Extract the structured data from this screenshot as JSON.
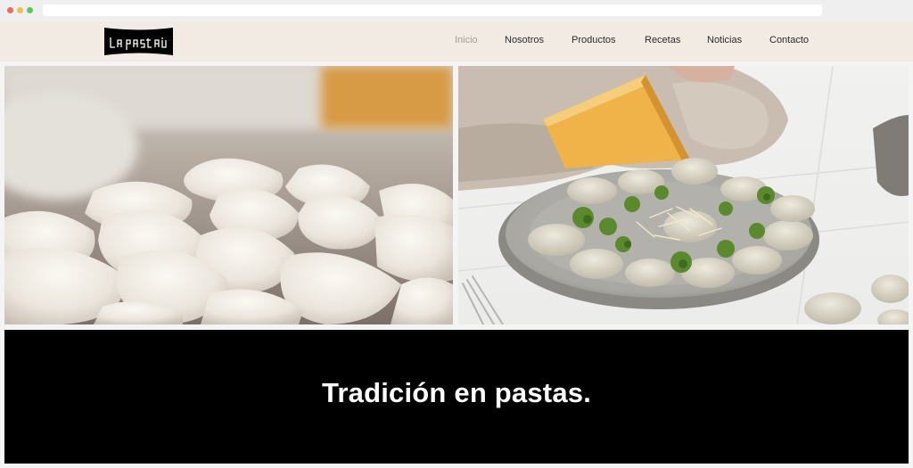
{
  "browser": {
    "window_controls": [
      "close",
      "minimize",
      "maximize"
    ],
    "url": ""
  },
  "header": {
    "logo_text": "la pasta",
    "nav": [
      {
        "label": "Inicio",
        "active": true
      },
      {
        "label": "Nosotros",
        "active": false
      },
      {
        "label": "Productos",
        "active": false
      },
      {
        "label": "Recetas",
        "active": false
      },
      {
        "label": "Noticias",
        "active": false
      },
      {
        "label": "Contacto",
        "active": false
      }
    ]
  },
  "hero": {
    "images": [
      {
        "subject": "fresh-ravioli-on-floured-board"
      },
      {
        "subject": "plate-of-ravioli-with-broccoli-and-cheese"
      }
    ]
  },
  "banner": {
    "tagline": "Tradición en pastas."
  },
  "colors": {
    "header_bg": "#f1ebe4",
    "nav_active": "#a49c94",
    "nav_text": "#2a2a2a",
    "banner_bg": "#000000",
    "banner_text": "#ffffff"
  }
}
